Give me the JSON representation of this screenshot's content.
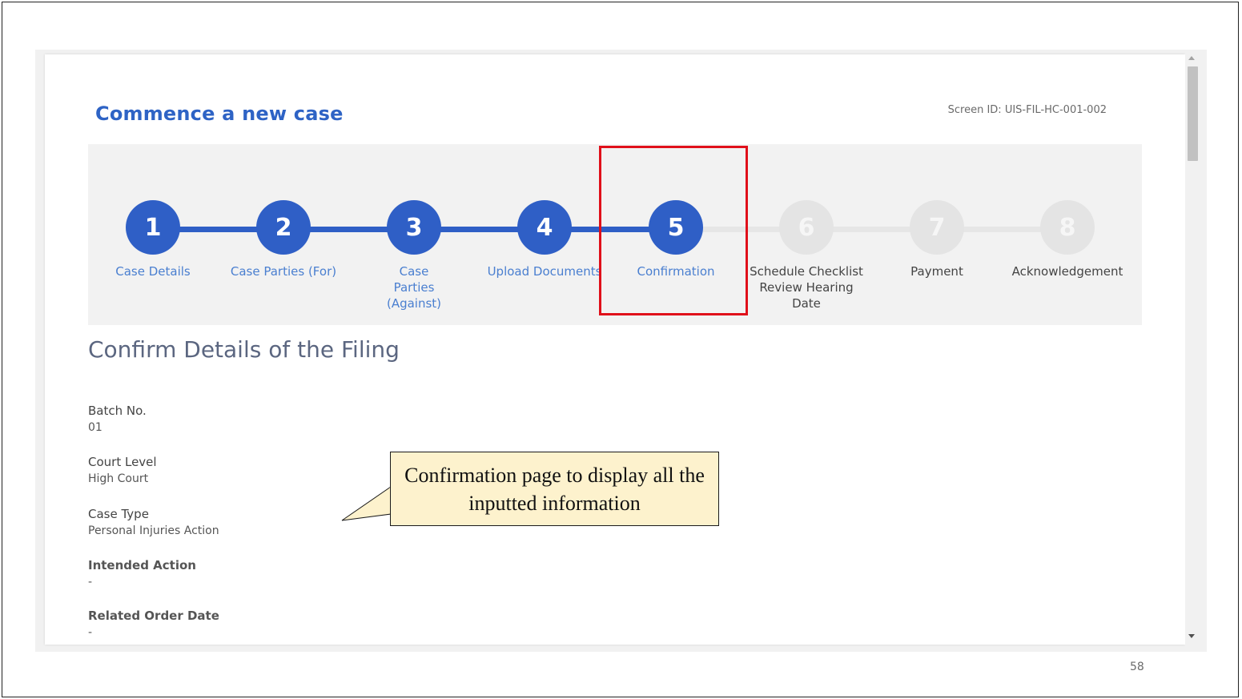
{
  "page": {
    "title": "Commence a new case",
    "screen_id": "Screen ID: UIS-FIL-HC-001-002"
  },
  "stepper": {
    "current_step": 5,
    "steps": [
      {
        "number": "1",
        "label": "Case Details",
        "state": "done"
      },
      {
        "number": "2",
        "label": "Case Parties (For)",
        "state": "done"
      },
      {
        "number": "3",
        "label": "Case Parties (Against)",
        "state": "done"
      },
      {
        "number": "4",
        "label": "Upload Documents",
        "state": "done"
      },
      {
        "number": "5",
        "label": "Confirmation",
        "state": "current"
      },
      {
        "number": "6",
        "label": "Schedule Checklist Review Hearing Date",
        "state": "pending"
      },
      {
        "number": "7",
        "label": "Payment",
        "state": "pending"
      },
      {
        "number": "8",
        "label": "Acknowledgement",
        "state": "pending"
      }
    ]
  },
  "confirmation": {
    "heading": "Confirm Details of the Filing",
    "fields": [
      {
        "label": "Batch No.",
        "value": "01"
      },
      {
        "label": "Court Level",
        "value": "High Court"
      },
      {
        "label": "Case Type",
        "value": "Personal Injuries Action"
      },
      {
        "label": "Intended Action",
        "value": "-"
      },
      {
        "label": "Related Order Date",
        "value": "-"
      }
    ]
  },
  "callout": {
    "text": "Confirmation page to display all the inputted information"
  },
  "slide": {
    "page_number": "58"
  },
  "colors": {
    "accent": "#2f5fc6",
    "title": "#2e63c5",
    "highlight": "#e0101a",
    "callout_bg": "#fdf2cd",
    "inactive_step": "#e4e4e4"
  }
}
